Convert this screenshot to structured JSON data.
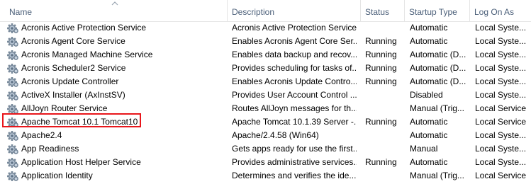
{
  "columns": {
    "name": "Name",
    "description": "Description",
    "status": "Status",
    "startup_type": "Startup Type",
    "log_on_as": "Log On As"
  },
  "rows": [
    {
      "name": "Acronis Active Protection Service",
      "description": "Acronis Active Protection Service",
      "status": "",
      "startup": "Automatic",
      "logon": "Local Syste..."
    },
    {
      "name": "Acronis Agent Core Service",
      "description": "Enables Acronis Agent Core Ser...",
      "status": "Running",
      "startup": "Automatic",
      "logon": "Local Syste..."
    },
    {
      "name": "Acronis Managed Machine Service",
      "description": "Enables data backup and recov...",
      "status": "Running",
      "startup": "Automatic (D...",
      "logon": "Local Syste..."
    },
    {
      "name": "Acronis Scheduler2 Service",
      "description": "Provides scheduling for tasks of...",
      "status": "Running",
      "startup": "Automatic (D...",
      "logon": "Local Syste..."
    },
    {
      "name": "Acronis Update Controller",
      "description": "Enables Acronis Update Contro...",
      "status": "Running",
      "startup": "Automatic (D...",
      "logon": "Local Syste..."
    },
    {
      "name": "ActiveX Installer (AxInstSV)",
      "description": "Provides User Account Control ...",
      "status": "",
      "startup": "Disabled",
      "logon": "Local Syste..."
    },
    {
      "name": "AllJoyn Router Service",
      "description": "Routes AllJoyn messages for th...",
      "status": "",
      "startup": "Manual (Trig...",
      "logon": "Local Service"
    },
    {
      "name": "Apache Tomcat 10.1 Tomcat10",
      "description": "Apache Tomcat 10.1.39 Server -...",
      "status": "Running",
      "startup": "Automatic",
      "logon": "Local Service"
    },
    {
      "name": "Apache2.4",
      "description": "Apache/2.4.58 (Win64)",
      "status": "",
      "startup": "Automatic",
      "logon": "Local Syste..."
    },
    {
      "name": "App Readiness",
      "description": "Gets apps ready for use the first...",
      "status": "",
      "startup": "Manual",
      "logon": "Local Syste..."
    },
    {
      "name": "Application Host Helper Service",
      "description": "Provides administrative services...",
      "status": "Running",
      "startup": "Automatic",
      "logon": "Local Syste..."
    },
    {
      "name": "Application Identity",
      "description": "Determines and verifies the ide...",
      "status": "",
      "startup": "Manual (Trig...",
      "logon": "Local Service"
    }
  ],
  "colors": {
    "highlight": "#e8161b",
    "header_text": "#4c607a"
  },
  "icons": {
    "service": "gear-icon",
    "sort": "sort-ascending-icon"
  }
}
